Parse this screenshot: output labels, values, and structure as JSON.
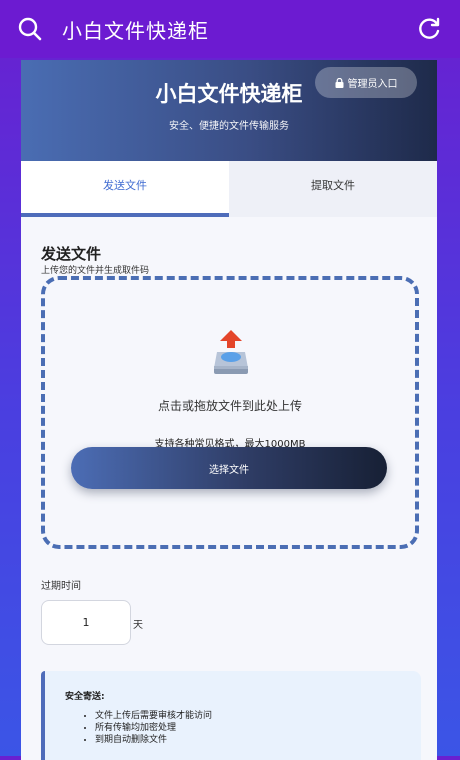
{
  "topbar": {
    "title": "小白文件快递柜"
  },
  "hero": {
    "title": "小白文件快递柜",
    "subtitle": "安全、便捷的文件传输服务",
    "admin_label": "管理员入口"
  },
  "tabs": [
    {
      "label": "发送文件",
      "active": true
    },
    {
      "label": "提取文件",
      "active": false
    }
  ],
  "send": {
    "title": "发送文件",
    "subtitle": "上传您的文件并生成取件码",
    "dropzone_text": "点击或拖放文件到此处上传",
    "dropzone_hint": "支持各种常见格式，最大1000MB",
    "choose_label": "选择文件"
  },
  "expire": {
    "label": "过期时间",
    "value": "1",
    "unit": "天"
  },
  "notice": {
    "title": "安全寄送:",
    "items": [
      "文件上传后需要审核才能访问",
      "所有传输均加密处理",
      "到期自动删除文件"
    ]
  },
  "colors": {
    "accent": "#4e6cba",
    "topbar": "#6c1bd1",
    "tab_active_text": "#3f6bd1"
  }
}
